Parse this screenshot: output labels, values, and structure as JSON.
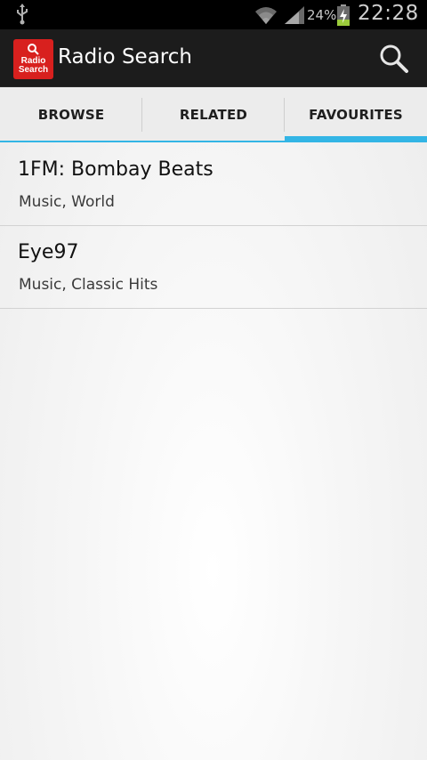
{
  "status_bar": {
    "battery_percent": "24%",
    "time": "22:28",
    "icons": [
      "usb-icon",
      "wifi-icon",
      "signal-icon",
      "battery-charging-icon"
    ]
  },
  "action_bar": {
    "logo_line1": "Radio",
    "logo_line2": "Search",
    "title": "Radio Search",
    "search_icon": "search-icon"
  },
  "tabs": [
    {
      "label": "BROWSE",
      "selected": false
    },
    {
      "label": "RELATED",
      "selected": false
    },
    {
      "label": "FAVOURITES",
      "selected": true
    }
  ],
  "stations": [
    {
      "name": "1FM: Bombay Beats",
      "genres": "Music, World"
    },
    {
      "name": "Eye97",
      "genres": "Music, Classic Hits"
    }
  ],
  "colors": {
    "accent": "#33b5e5",
    "logo_red": "#d8201e",
    "action_bar_bg": "#1c1c1c",
    "status_bar_bg": "#000000"
  }
}
